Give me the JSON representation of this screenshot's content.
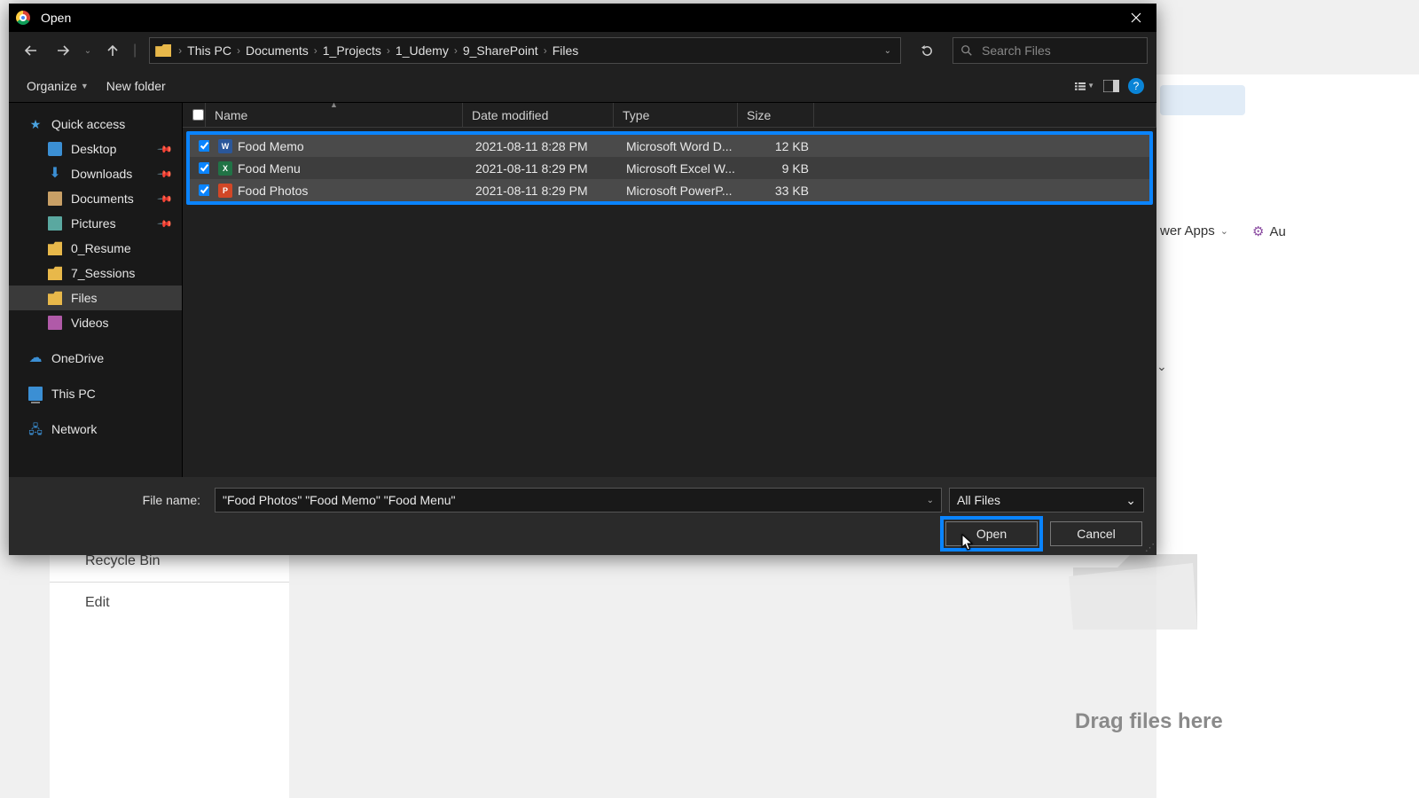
{
  "titlebar": {
    "title": "Open"
  },
  "nav": {
    "back": "←",
    "forward": "→",
    "up": "↑",
    "crumbs": [
      "This PC",
      "Documents",
      "1_Projects",
      "1_Udemy",
      "9_SharePoint",
      "Files"
    ],
    "search_placeholder": "Search Files"
  },
  "toolbar": {
    "organize": "Organize",
    "newfolder": "New folder"
  },
  "sidebar": {
    "quick_access": "Quick access",
    "items": [
      {
        "label": "Desktop",
        "icon": "desktop",
        "pinned": true
      },
      {
        "label": "Downloads",
        "icon": "download",
        "pinned": true
      },
      {
        "label": "Documents",
        "icon": "doc",
        "pinned": true
      },
      {
        "label": "Pictures",
        "icon": "pic",
        "pinned": true
      },
      {
        "label": "0_Resume",
        "icon": "folder",
        "pinned": false
      },
      {
        "label": "7_Sessions",
        "icon": "folder",
        "pinned": false
      },
      {
        "label": "Files",
        "icon": "folder",
        "pinned": false,
        "selected": true
      },
      {
        "label": "Videos",
        "icon": "video",
        "pinned": false
      }
    ],
    "onedrive": "OneDrive",
    "thispc": "This PC",
    "network": "Network"
  },
  "columns": {
    "name": "Name",
    "date": "Date modified",
    "type": "Type",
    "size": "Size"
  },
  "files": [
    {
      "name": "Food Memo",
      "date": "2021-08-11 8:28 PM",
      "type": "Microsoft Word D...",
      "size": "12 KB",
      "app": "word"
    },
    {
      "name": "Food Menu",
      "date": "2021-08-11 8:29 PM",
      "type": "Microsoft Excel W...",
      "size": "9 KB",
      "app": "excel"
    },
    {
      "name": "Food Photos",
      "date": "2021-08-11 8:29 PM",
      "type": "Microsoft PowerP...",
      "size": "33 KB",
      "app": "ppt"
    }
  ],
  "bottom": {
    "filename_label": "File name:",
    "filename_value": "\"Food Photos\" \"Food Memo\" \"Food Menu\"",
    "filter": "All Files",
    "open": "Open",
    "cancel": "Cancel"
  },
  "backdrop": {
    "recycle": "Recycle Bin",
    "edit": "Edit",
    "apps": "wer Apps",
    "au": "Au",
    "drag": "Drag files here"
  }
}
